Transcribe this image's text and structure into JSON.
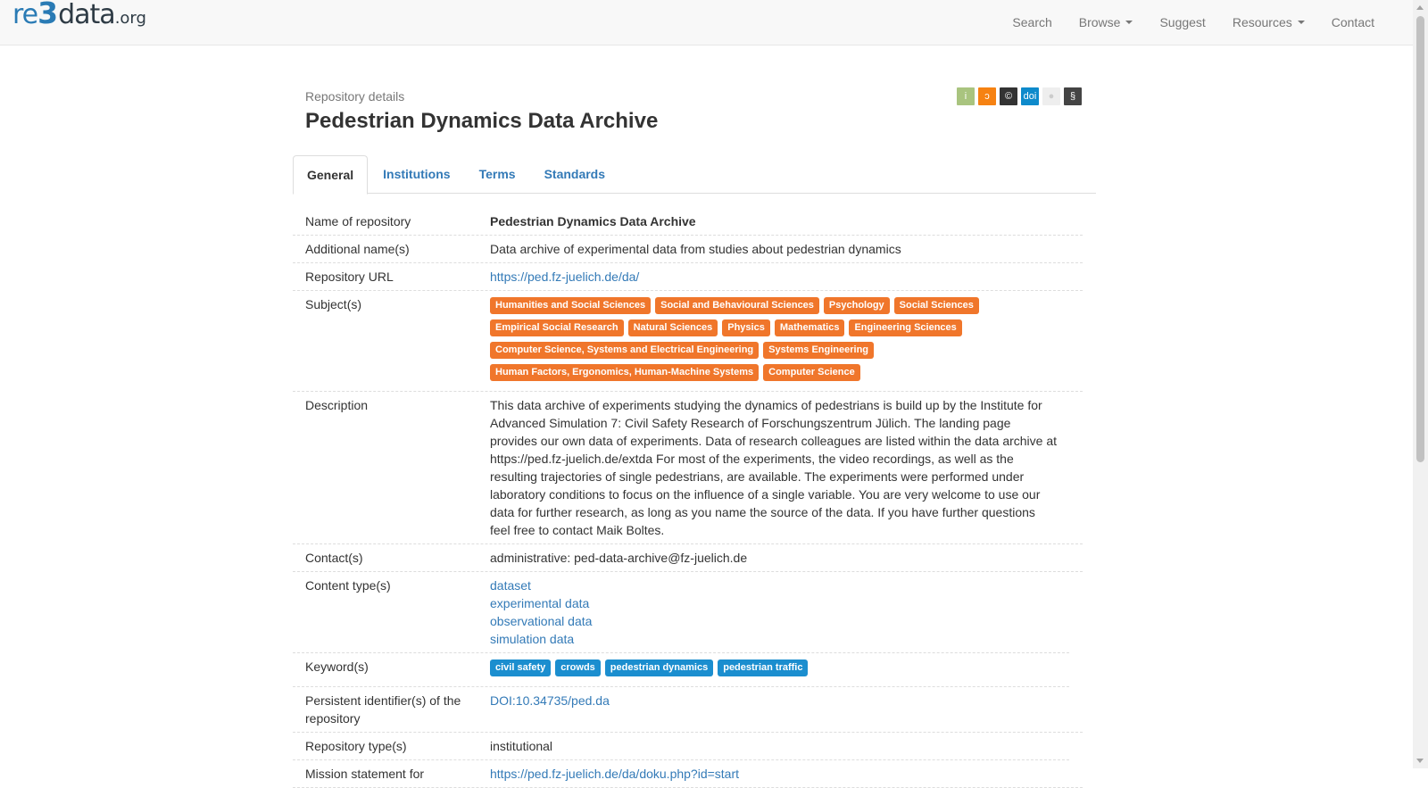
{
  "navbar": {
    "logo": {
      "re": "re",
      "three": "3",
      "data": "data",
      "org": ".org"
    },
    "items": [
      "Search",
      "Browse",
      "Suggest",
      "Resources",
      "Contact"
    ]
  },
  "header": {
    "subtitle": "Repository details",
    "title": "Pedestrian Dynamics Data Archive",
    "badges": [
      {
        "icon": "info-icon",
        "glyph": "i",
        "color": "#a9c47f"
      },
      {
        "icon": "open-access-icon",
        "glyph": "ɔ",
        "color": "#f68212"
      },
      {
        "icon": "copyright-icon",
        "glyph": "©",
        "color": "#333333"
      },
      {
        "icon": "doi-icon",
        "glyph": "doi",
        "color": "#0e8acb"
      },
      {
        "icon": "certificate-icon",
        "glyph": "●",
        "color": "#eeeeee"
      },
      {
        "icon": "policy-icon",
        "glyph": "§",
        "color": "#444444"
      }
    ]
  },
  "tabs": [
    "General",
    "Institutions",
    "Terms",
    "Standards"
  ],
  "details": {
    "name": {
      "label": "Name of repository",
      "value": "Pedestrian Dynamics Data Archive"
    },
    "additional_name": {
      "label": "Additional name(s)",
      "value": "Data archive of experimental data from studies about pedestrian dynamics"
    },
    "url": {
      "label": "Repository URL",
      "value": "https://ped.fz-juelich.de/da/"
    },
    "subjects": {
      "label": "Subject(s)",
      "items": [
        "Humanities and Social Sciences",
        "Social and Behavioural Sciences",
        "Psychology",
        "Social Sciences",
        "Empirical Social Research",
        "Natural Sciences",
        "Physics",
        "Mathematics",
        "Engineering Sciences",
        "Computer Science, Systems and Electrical Engineering",
        "Systems Engineering",
        "Human Factors, Ergonomics, Human-Machine Systems",
        "Computer Science"
      ]
    },
    "description": {
      "label": "Description",
      "value": "This data archive of experiments studying the dynamics of pedestrians is build up by the Institute for Advanced Simulation 7: Civil Safety Research of Forschungszentrum Jülich. The landing page provides our own data of experiments. Data of research colleagues are listed within the data archive at https://ped.fz-juelich.de/extda For most of the experiments, the video recordings, as well as the resulting trajectories of single pedestrians, are available. The experiments were performed under laboratory conditions to focus on the influence of a single variable. You are very welcome to use our data for further research, as long as you name the source of the data. If you have further questions feel free to contact Maik Boltes."
    },
    "contacts": {
      "label": "Contact(s)",
      "value": "administrative: ped-data-archive@fz-juelich.de"
    },
    "content_types": {
      "label": "Content type(s)",
      "items": [
        "dataset",
        "experimental data",
        "observational data",
        "simulation data"
      ]
    },
    "keywords": {
      "label": "Keyword(s)",
      "items": [
        "civil safety",
        "crowds",
        "pedestrian dynamics",
        "pedestrian traffic"
      ]
    },
    "pid": {
      "label": "Persistent identifier(s) of the repository",
      "value": "DOI:10.34735/ped.da"
    },
    "repo_type": {
      "label": "Repository type(s)",
      "value": "institutional"
    },
    "mission": {
      "label": "Mission statement for",
      "value": "https://ped.fz-juelich.de/da/doku.php?id=start"
    }
  }
}
